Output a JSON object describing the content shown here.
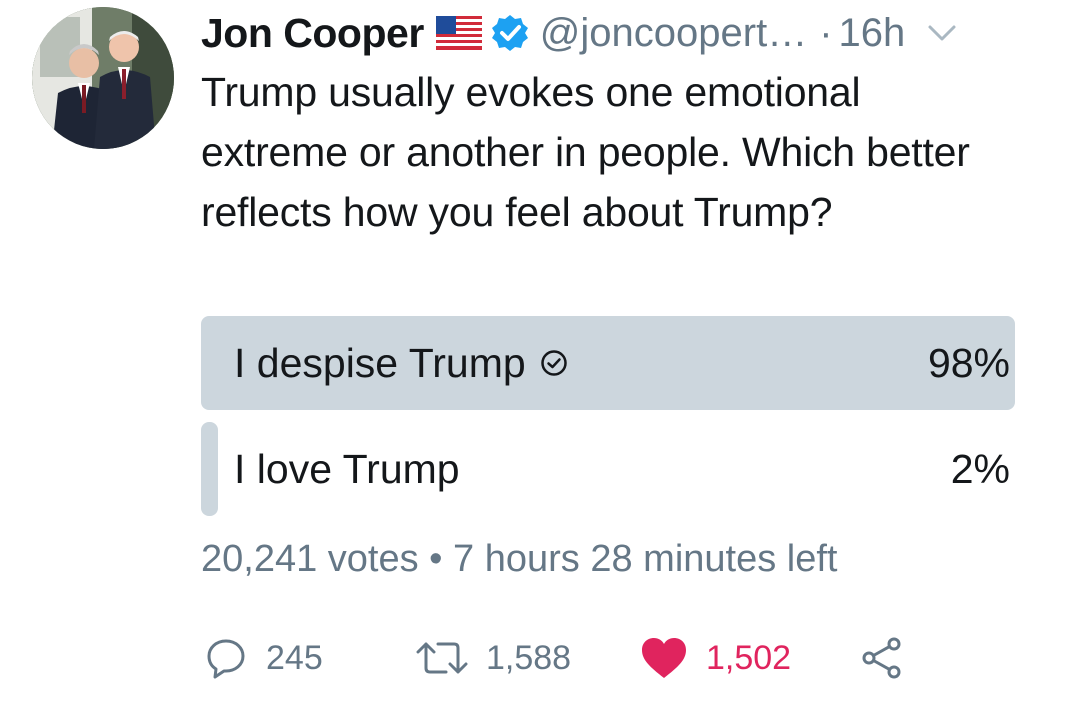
{
  "author": {
    "name": "Jon Cooper",
    "handle": "@joncoopert…",
    "separator": "·",
    "time": "16h",
    "flag_icon": "us-flag-emoji",
    "verified_icon": "verified-badge-icon",
    "verified_color": "#1da1f2"
  },
  "tweet": {
    "text": "Trump usually evokes one emotional extreme or another in people. Which better reflects how you feel about Trump?"
  },
  "poll": {
    "options": [
      {
        "label": "I despise Trump",
        "percent": "98%",
        "share": 98,
        "winner": true
      },
      {
        "label": "I love Trump",
        "percent": "2%",
        "share": 2,
        "winner": false
      }
    ],
    "votes": "20,241 votes",
    "bullet": "•",
    "time_left": "7 hours 28 minutes left",
    "bar_color": "#ccd6dd"
  },
  "actions": {
    "replies": "245",
    "retweets": "1,588",
    "likes": "1,502",
    "like_color": "#e0245e",
    "muted_color": "#657786"
  }
}
